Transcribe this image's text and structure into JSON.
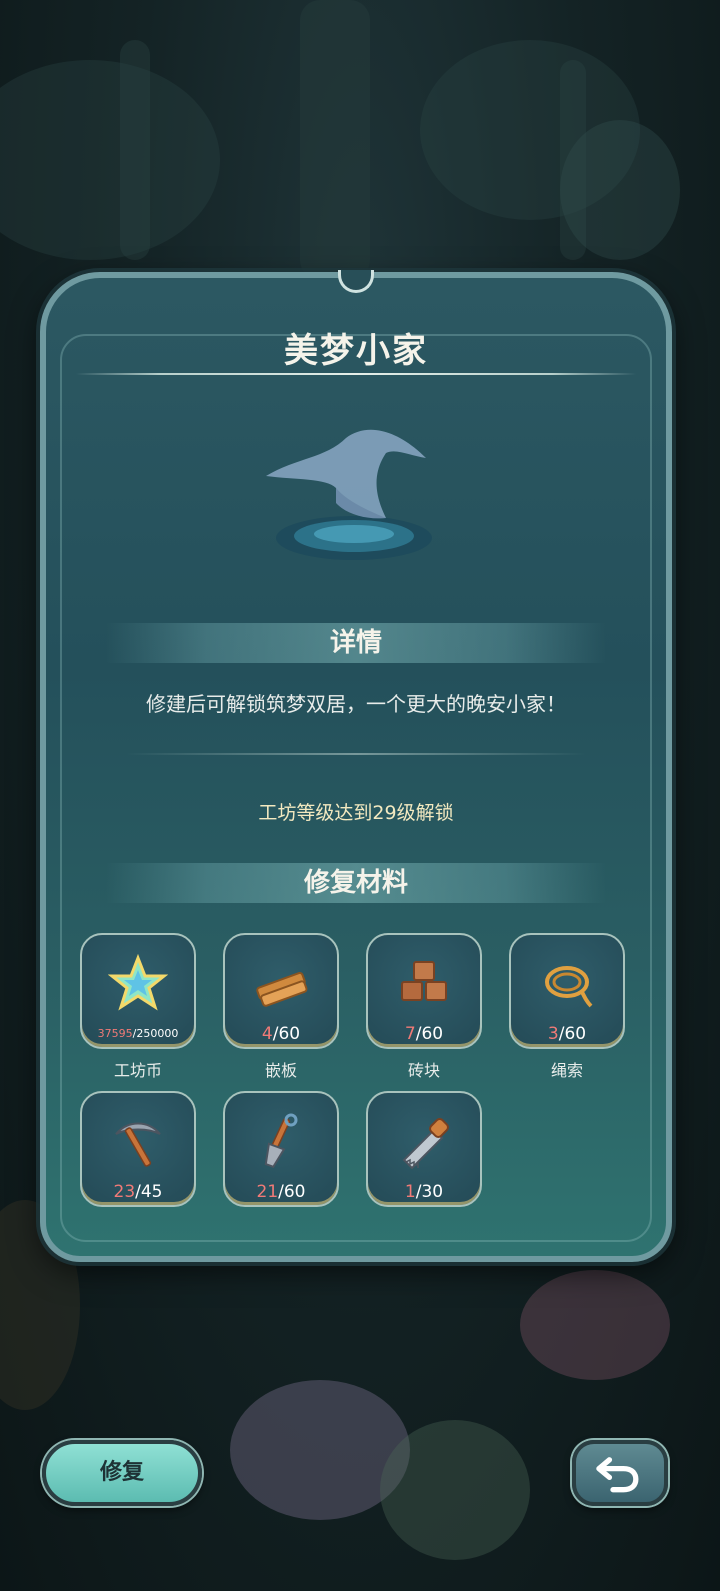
{
  "panel": {
    "title": "美梦小家",
    "details_heading": "详情",
    "description": "修建后可解锁筑梦双居，一个更大的晚安小家！",
    "unlock_requirement": "工坊等级达到29级解锁",
    "materials_heading": "修复材料"
  },
  "materials": [
    {
      "name": "工坊币",
      "have": "37595",
      "need": "/250000",
      "icon": "star-coin-icon"
    },
    {
      "name": "嵌板",
      "have": "4",
      "need": "/60",
      "icon": "wood-plank-icon"
    },
    {
      "name": "砖块",
      "have": "7",
      "need": "/60",
      "icon": "brick-icon"
    },
    {
      "name": "绳索",
      "have": "3",
      "need": "/60",
      "icon": "rope-icon"
    },
    {
      "name": "",
      "have": "23",
      "need": "/45",
      "icon": "pickaxe-icon"
    },
    {
      "name": "",
      "have": "21",
      "need": "/60",
      "icon": "shovel-icon"
    },
    {
      "name": "",
      "have": "1",
      "need": "/30",
      "icon": "saw-icon"
    }
  ],
  "buttons": {
    "repair_label": "修复",
    "back_icon": "undo-arrow-icon"
  },
  "colors": {
    "panel": "#2c5862",
    "insufficient": "#f07a77",
    "repair_button": "#7fd3c8",
    "unlock_text": "#f3e9c0"
  }
}
